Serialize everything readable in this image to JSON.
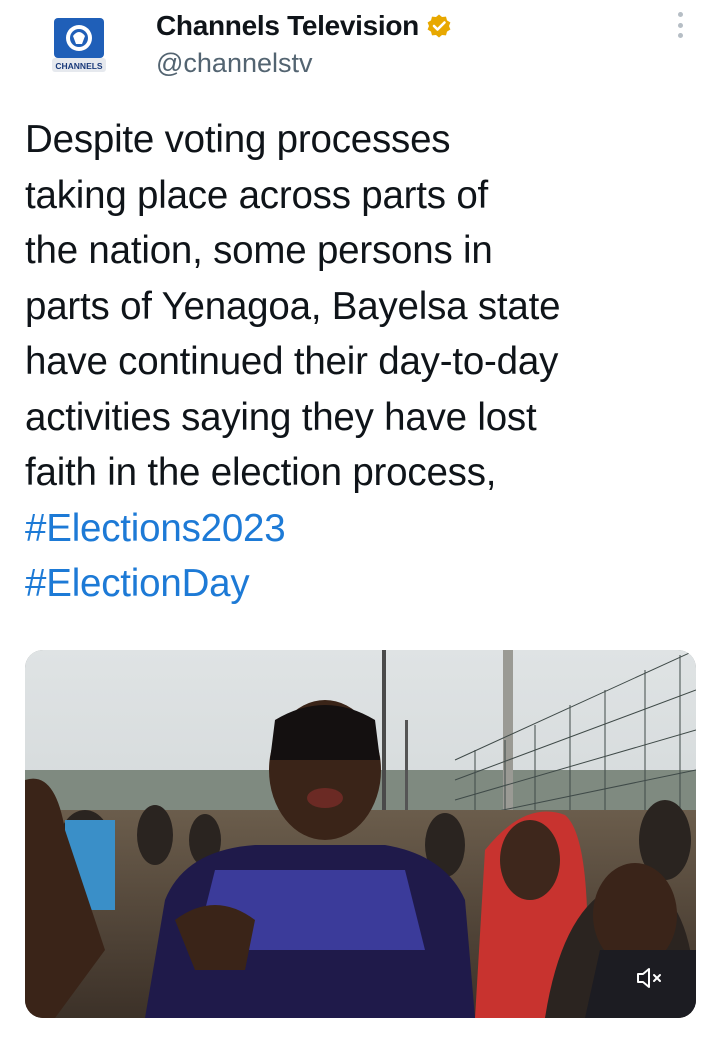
{
  "account": {
    "display_name": "Channels Television",
    "handle": "@channelstv",
    "avatar_label": "CHANNELS",
    "verified": true
  },
  "tweet": {
    "text_lines": [
      "Despite voting processes",
      "taking place across parts of",
      "the nation, some persons in",
      "parts of Yenagoa, Bayelsa state",
      "have continued their day-to-day",
      "activities saying they have lost",
      "faith in the election process,"
    ],
    "hashtags": [
      "#Elections2023",
      "#ElectionDay"
    ]
  },
  "media": {
    "type": "video",
    "muted": true
  },
  "colors": {
    "text": "#0f1419",
    "secondary_text": "#536471",
    "hashtag": "#1d7ad6",
    "verified_badge": "#e8a800"
  }
}
